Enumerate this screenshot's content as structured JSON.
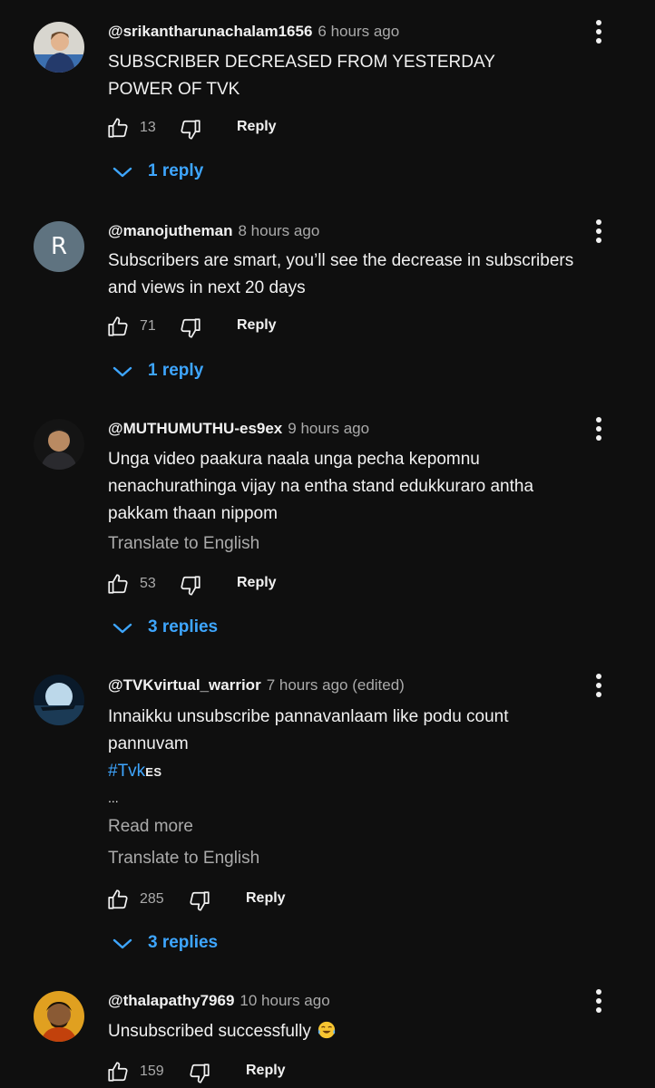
{
  "comments": [
    {
      "handle": "@srikantharunachalam1656",
      "time": "6 hours ago",
      "lines": [
        "SUBSCRIBER DECREASED FROM YESTERDAY",
        "POWER OF TVK"
      ],
      "likes": "13",
      "reply_label": "Reply",
      "replies_label": "1 reply"
    },
    {
      "handle": "@manojutheman",
      "time": "8 hours ago",
      "avatar_letter": "R",
      "lines": [
        "Subscribers are smart, you’ll see the decrease in subscribers",
        "and views in next 20 days"
      ],
      "likes": "71",
      "reply_label": "Reply",
      "replies_label": "1 reply"
    },
    {
      "handle": "@MUTHUMUTHU-es9ex",
      "time": "9 hours ago",
      "lines": [
        "Unga video paakura naala unga pecha kepomnu",
        "nenachurathinga vijay na entha stand edukkuraro antha",
        "pakkam thaan nippom"
      ],
      "translate_label": "Translate to English",
      "likes": "53",
      "reply_label": "Reply",
      "replies_label": "3 replies"
    },
    {
      "handle": "@TVKvirtual_warrior",
      "time": "7 hours ago (edited)",
      "lines": [
        "Innaikku unsubscribe pannavanlaam like podu count",
        "pannuvam"
      ],
      "hashtag": "#Tvk",
      "hashtag_suffix": "ES",
      "ellipsis": "...",
      "read_more_label": "Read more",
      "translate_label": "Translate to English",
      "likes": "285",
      "reply_label": "Reply",
      "replies_label": "3 replies"
    },
    {
      "handle": "@thalapathy7969",
      "time": "10 hours ago",
      "lines": [
        "Unsubscribed successfully"
      ],
      "likes": "159",
      "reply_label": "Reply"
    }
  ],
  "icons": {
    "like": "thumbs-up-icon",
    "dislike": "thumbs-down-icon",
    "menu": "more-vertical-icon",
    "expand": "chevron-down-icon",
    "emoji": "tears-of-joy-emoji"
  },
  "colors": {
    "background": "#0f0f0f",
    "text": "#f1f1f1",
    "muted": "#aaaaaa",
    "link": "#3ea6ff"
  }
}
